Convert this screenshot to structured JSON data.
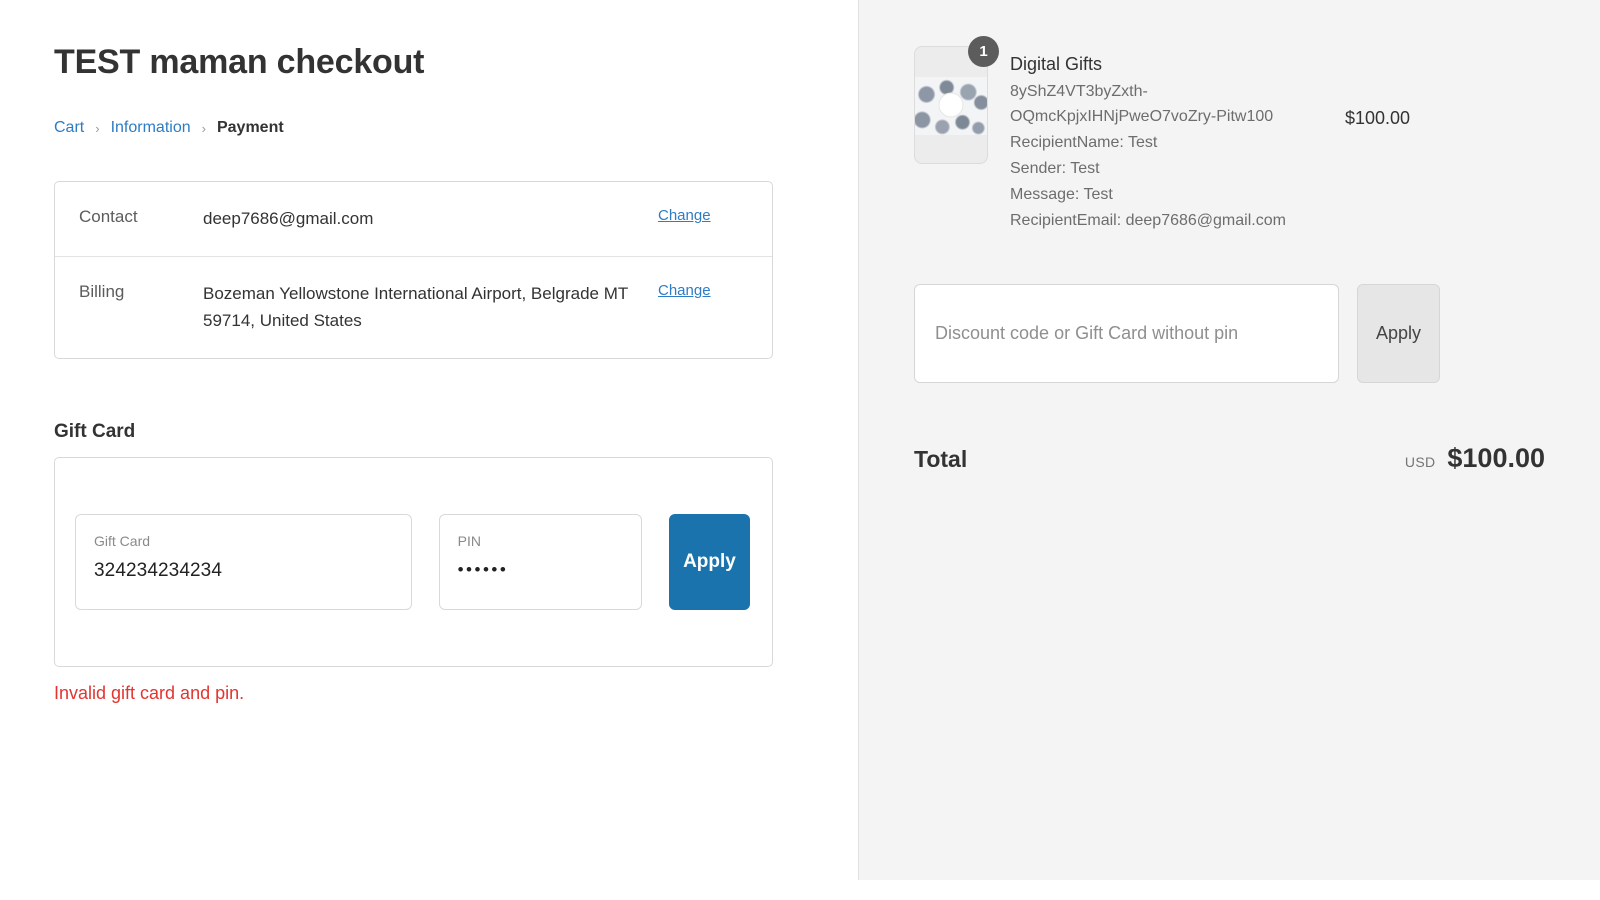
{
  "header": {
    "title": "TEST maman checkout",
    "breadcrumb": {
      "cart": "Cart",
      "separator": "›",
      "information": "Information",
      "payment": "Payment"
    }
  },
  "review": {
    "contact": {
      "label": "Contact",
      "value": "deep7686@gmail.com",
      "change_label": "Change"
    },
    "billing": {
      "label": "Billing",
      "value": "Bozeman Yellowstone International Airport, Belgrade MT 59714, United States",
      "change_label": "Change"
    }
  },
  "gift_card": {
    "heading": "Gift Card",
    "number_label": "Gift Card",
    "number_value": "324234234234",
    "pin_label": "PIN",
    "pin_value": "••••••",
    "apply_label": "Apply",
    "error": "Invalid gift card and pin."
  },
  "summary": {
    "item": {
      "quantity": "1",
      "title": "Digital Gifts",
      "variant": "8yShZ4VT3byZxth-OQmcKpjxIHNjPweO7voZry-Pitw100",
      "properties": [
        "RecipientName: Test",
        "Sender: Test",
        "Message: Test",
        "RecipientEmail: deep7686@gmail.com"
      ],
      "price": "$100.00"
    },
    "discount": {
      "placeholder": "Discount code or Gift Card without pin",
      "value": "",
      "apply_label": "Apply"
    },
    "total": {
      "label": "Total",
      "currency": "USD",
      "amount": "$100.00"
    }
  },
  "colors": {
    "link": "#2e7cc3",
    "primary_button": "#1a73ac",
    "error": "#e3342f",
    "panel_bg": "#f4f4f4"
  }
}
